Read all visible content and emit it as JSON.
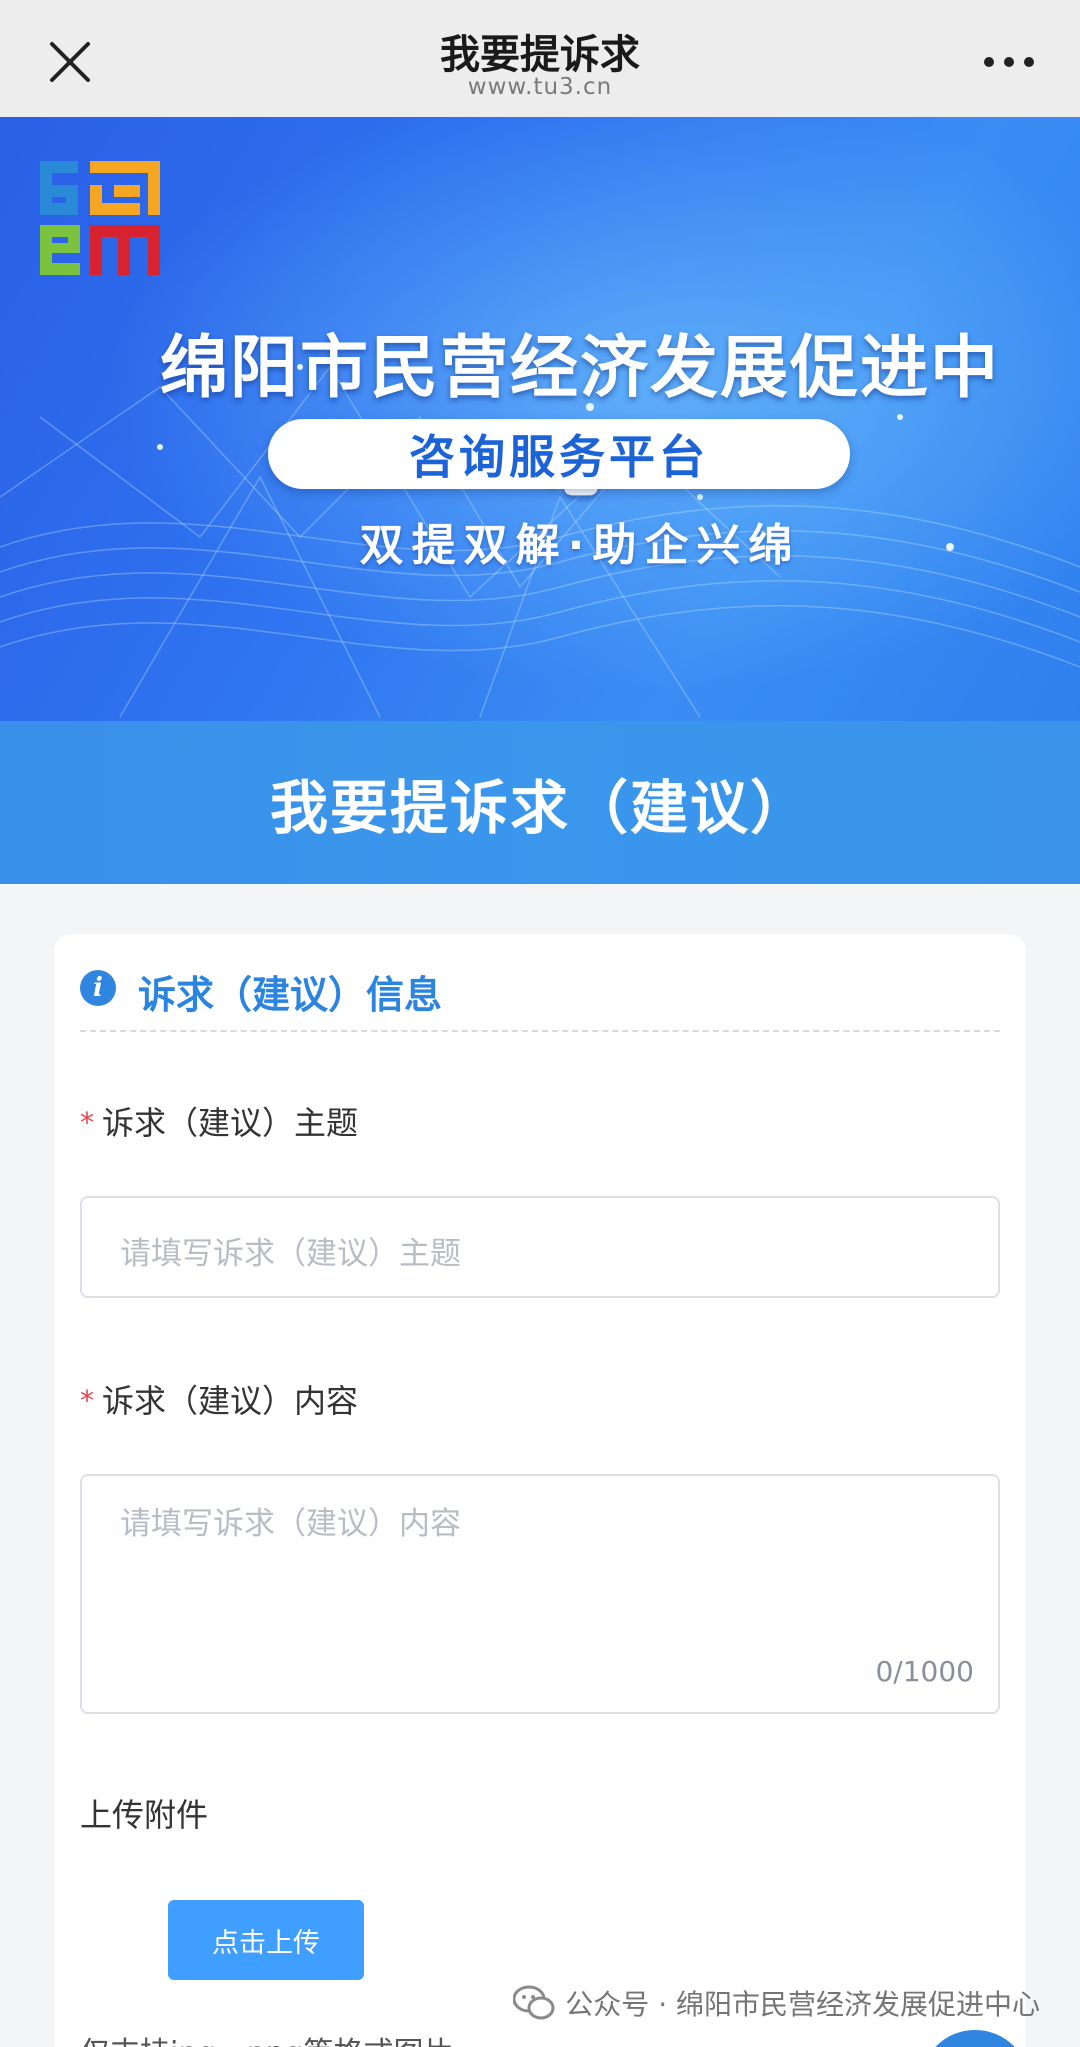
{
  "navbar": {
    "title": "我要提诉求",
    "url": "www.tu3.cn"
  },
  "banner": {
    "logo_text": "SEM",
    "title": "绵阳市民营经济发展促进中心",
    "pill": "咨询服务平台",
    "slogan": "双提双解·助企兴绵"
  },
  "header": {
    "title": "我要提诉求（建议）"
  },
  "form": {
    "section_title": "诉求（建议）信息",
    "subject": {
      "label": "诉求（建议）主题",
      "required_mark": "*",
      "placeholder": "请填写诉求（建议）主题",
      "value": ""
    },
    "content": {
      "label": "诉求（建议）内容",
      "required_mark": "*",
      "placeholder": "请填写诉求（建议）内容",
      "value": "",
      "counter": "0/1000"
    },
    "upload": {
      "label": "上传附件",
      "button": "点击上传",
      "hint": "仅支持jpg、png等格式图片"
    }
  },
  "watermark": {
    "text": "公众号 · 绵阳市民营经济发展促进中心"
  },
  "colors": {
    "accent": "#2a84e0",
    "upload_button": "#409eff",
    "required": "#e5484d",
    "banner_blue": "#2f74f0"
  }
}
